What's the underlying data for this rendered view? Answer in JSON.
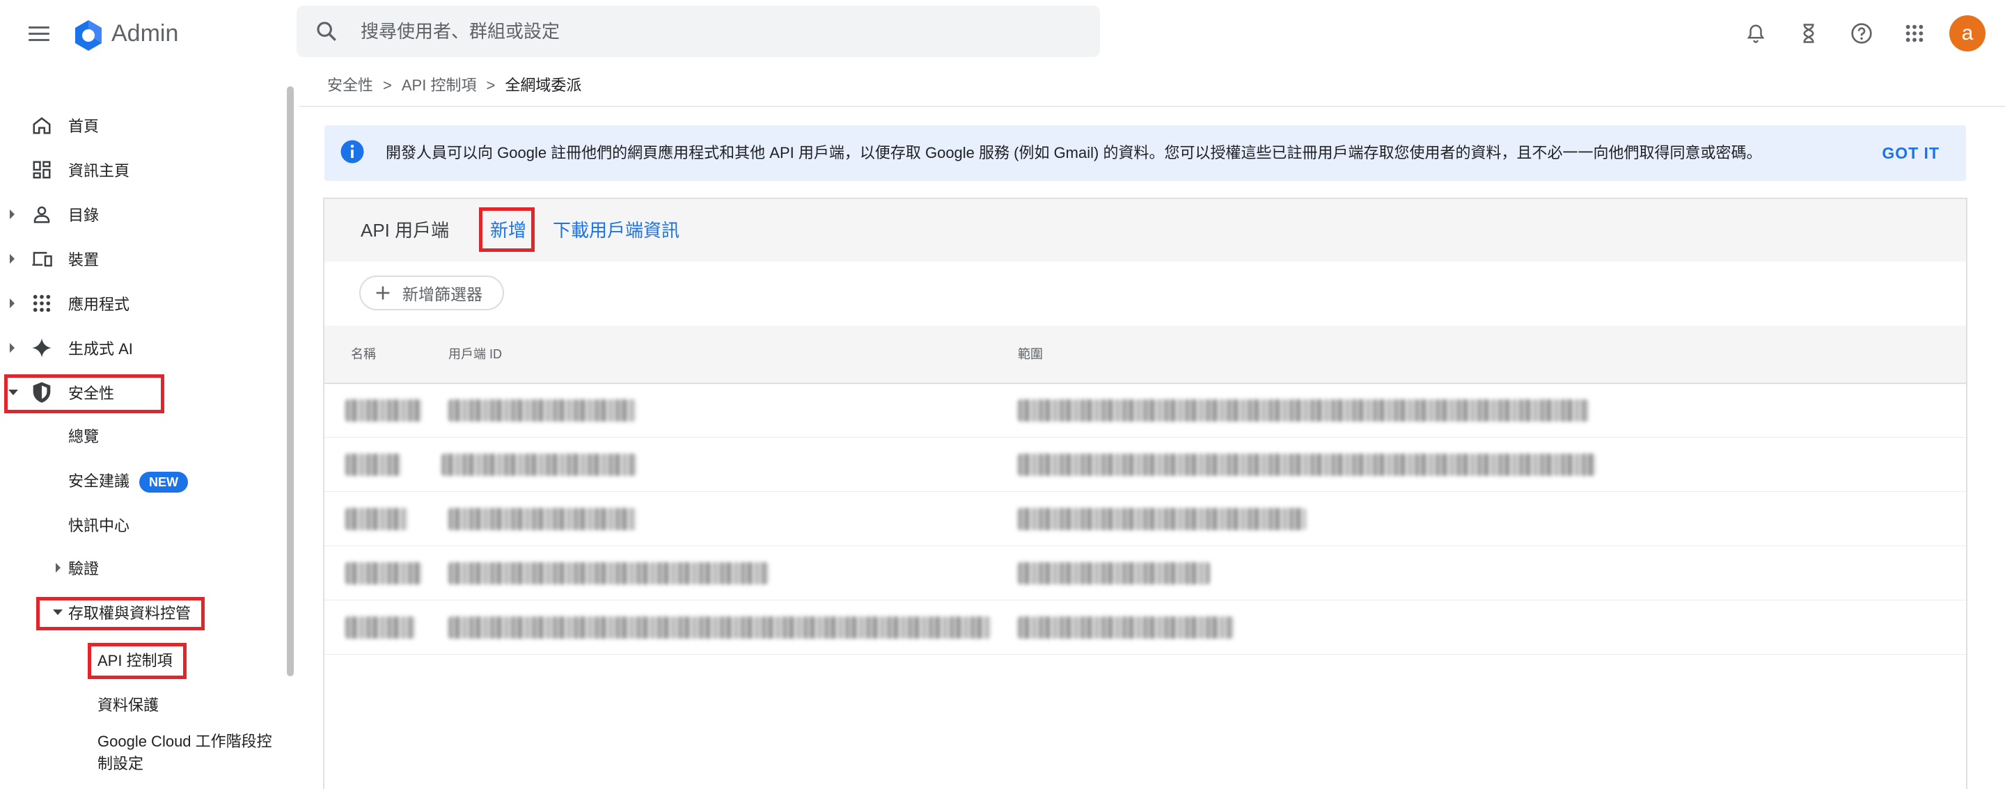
{
  "app": {
    "title": "Admin",
    "avatar_letter": "a"
  },
  "search": {
    "placeholder": "搜尋使用者、群組或設定"
  },
  "colors": {
    "accent": "#1a73e8",
    "highlight": "#e0262b",
    "avatar": "#e8711c"
  },
  "sidebar": {
    "items": [
      {
        "label": "首頁",
        "icon": "home-icon"
      },
      {
        "label": "資訊主頁",
        "icon": "dashboard-icon"
      },
      {
        "label": "目錄",
        "icon": "person-icon"
      },
      {
        "label": "裝置",
        "icon": "devices-icon"
      },
      {
        "label": "應用程式",
        "icon": "apps-grid-icon"
      },
      {
        "label": "生成式 AI",
        "icon": "sparkle-icon"
      },
      {
        "label": "安全性",
        "icon": "shield-icon"
      }
    ],
    "security_sub": {
      "overview": "總覽",
      "recommendations": "安全建議",
      "new_badge": "NEW",
      "alert_center": "快訊中心",
      "authentication": "驗證",
      "access_data_control": "存取權與資料控管",
      "api_controls": "API 控制項",
      "data_protection": "資料保護",
      "cloud_session_line1": "Google Cloud 工作階段控",
      "cloud_session_line2": "制設定"
    }
  },
  "breadcrumb": {
    "level1": "安全性",
    "level2": "API 控制項",
    "current": "全網域委派",
    "separator": ">"
  },
  "banner": {
    "text": "開發人員可以向 Google 註冊他們的網頁應用程式和其他 API 用戶端，以便存取 Google 服務 (例如 Gmail) 的資料。您可以授權這些已註冊用戶端存取您使用者的資料，且不必一一向他們取得同意或密碼。",
    "action": "GOT IT"
  },
  "card": {
    "title": "API 用戶端",
    "add_label": "新增",
    "download_label": "下載用戶端資訊",
    "filter_label": "新增篩選器",
    "columns": {
      "name": "名稱",
      "client_id": "用戶端 ID",
      "scopes": "範圍"
    },
    "rows": [
      {
        "name": "",
        "client_id": "",
        "scopes": ""
      },
      {
        "name": "",
        "client_id": "",
        "scopes": ""
      },
      {
        "name": "",
        "client_id": "",
        "scopes": ""
      },
      {
        "name": "",
        "client_id": "",
        "scopes": ""
      },
      {
        "name": "",
        "client_id": "",
        "scopes": ""
      }
    ]
  }
}
